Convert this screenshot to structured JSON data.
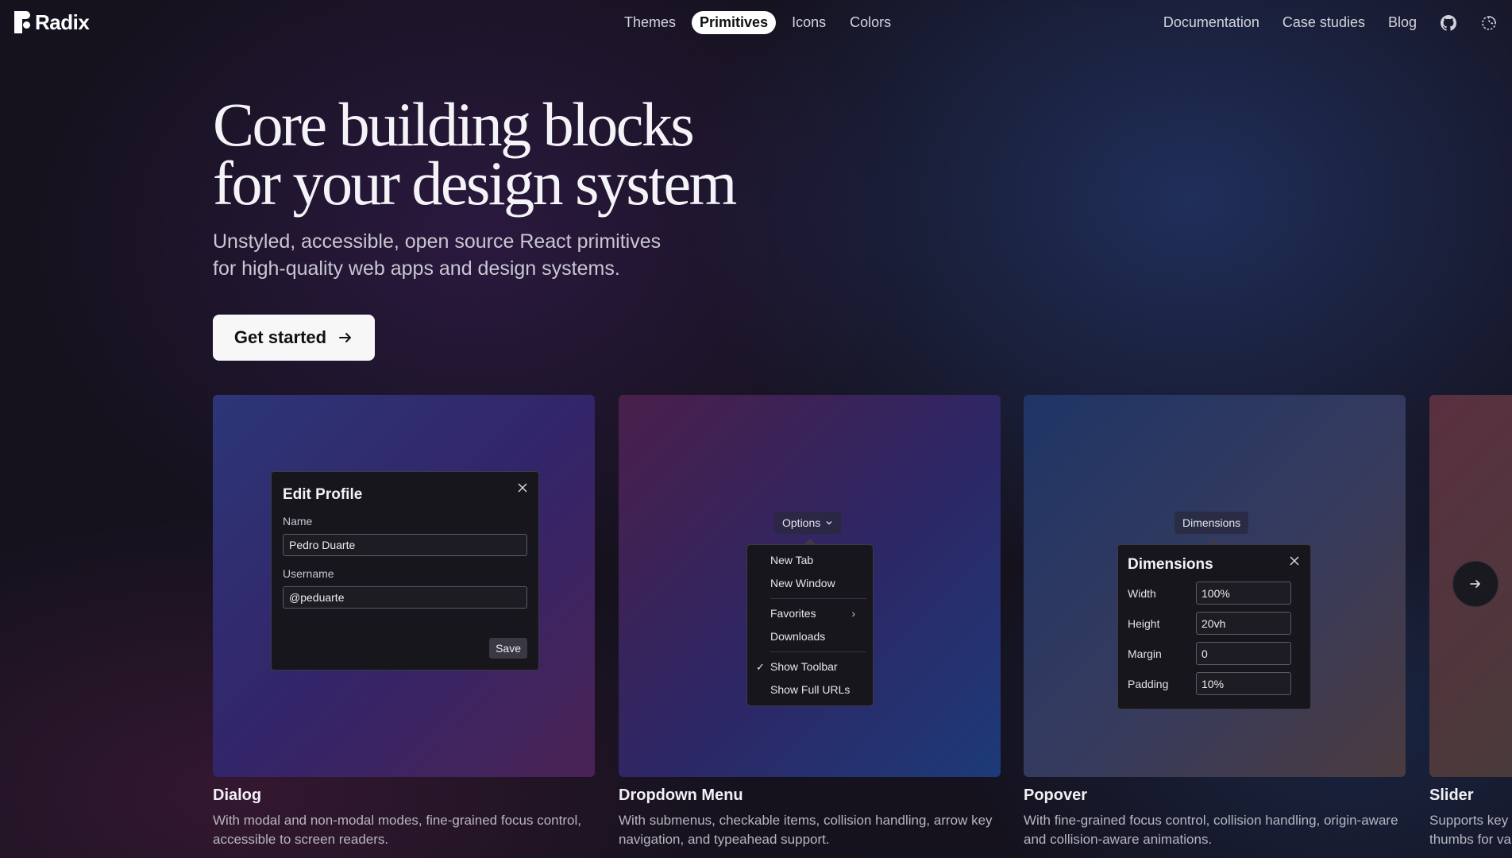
{
  "brand": {
    "name": "Radix"
  },
  "nav": {
    "center": [
      "Themes",
      "Primitives",
      "Icons",
      "Colors"
    ],
    "active": "Primitives",
    "right": [
      "Documentation",
      "Case studies",
      "Blog"
    ],
    "icons": [
      "github-icon",
      "theme-toggle-icon"
    ]
  },
  "hero": {
    "title": "Core building blocks\nfor your design system",
    "subtitle": "Unstyled, accessible, open source React primitives\nfor high-quality web apps and design systems.",
    "cta": "Get started"
  },
  "cards": [
    {
      "title": "Dialog",
      "desc": "With modal and non-modal modes, fine-grained focus control, accessible to screen readers.",
      "demo": {
        "heading": "Edit Profile",
        "name_label": "Name",
        "name_value": "Pedro Duarte",
        "username_label": "Username",
        "username_value": "@peduarte",
        "save": "Save"
      }
    },
    {
      "title": "Dropdown Menu",
      "desc": "With submenus, checkable items, collision handling, arrow key navigation, and typeahead support.",
      "demo": {
        "trigger": "Options",
        "items": [
          "New Tab",
          "New Window",
          "Favorites",
          "Downloads",
          "Show Toolbar",
          "Show Full URLs"
        ],
        "checked": "Show Toolbar"
      }
    },
    {
      "title": "Popover",
      "desc": "With fine-grained focus control, collision handling, origin-aware and collision-aware animations.",
      "demo": {
        "trigger": "Dimensions",
        "heading": "Dimensions",
        "rows": [
          {
            "label": "Width",
            "value": "100%"
          },
          {
            "label": "Height",
            "value": "20vh"
          },
          {
            "label": "Margin",
            "value": "0"
          },
          {
            "label": "Padding",
            "value": "10%"
          }
        ]
      }
    },
    {
      "title": "Slider",
      "desc_lines": [
        "Supports key",
        "thumbs for va"
      ]
    }
  ]
}
